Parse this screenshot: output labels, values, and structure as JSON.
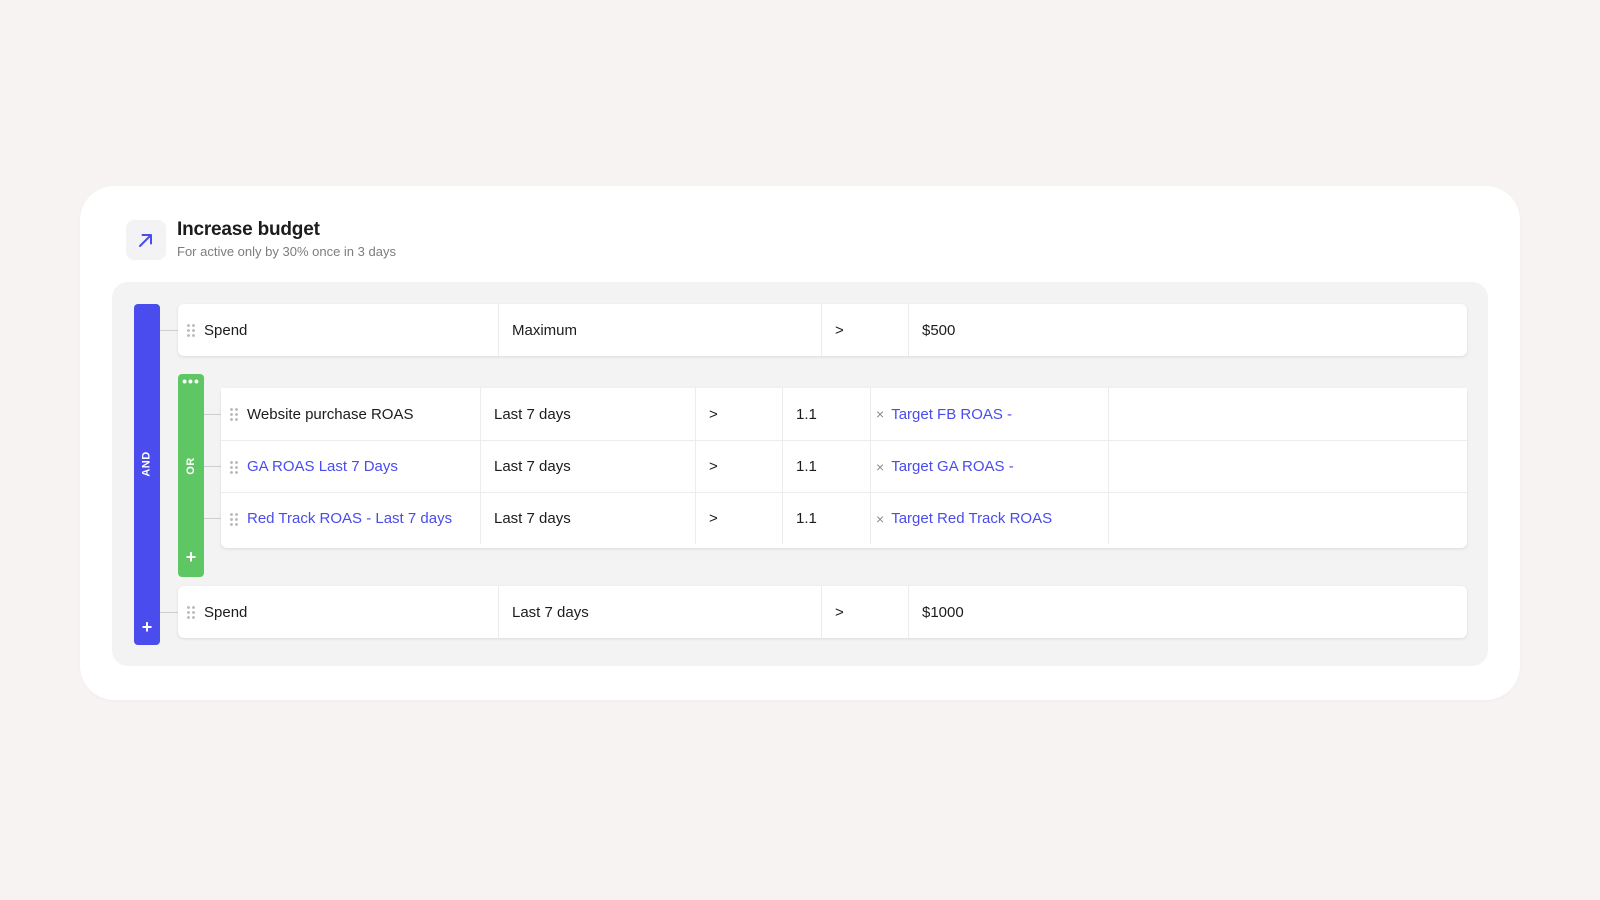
{
  "header": {
    "icon": "arrow-up-right-icon",
    "title": "Increase budget",
    "subtitle": "For active only by 30% once in 3 days"
  },
  "logic": {
    "and_label": "AND",
    "or_label": "OR",
    "add_symbol": "+",
    "more_symbol": "•••"
  },
  "rules": {
    "spend_max": {
      "metric": "Spend",
      "aggregation": "Maximum",
      "operator": ">",
      "value": "$500"
    },
    "or_group": [
      {
        "metric": "Website purchase ROAS",
        "metric_is_link": false,
        "period": "Last 7 days",
        "operator": ">",
        "value": "1.1",
        "multiplier_symbol": "×",
        "target": "Target FB ROAS -"
      },
      {
        "metric": "GA ROAS Last 7 Days",
        "metric_is_link": true,
        "period": "Last 7 days",
        "operator": ">",
        "value": "1.1",
        "multiplier_symbol": "×",
        "target": "Target GA ROAS -"
      },
      {
        "metric": "Red Track ROAS - Last 7 days",
        "metric_is_link": true,
        "period": "Last 7 days",
        "operator": ">",
        "value": "1.1",
        "multiplier_symbol": "×",
        "target": "Target Red Track ROAS"
      }
    ],
    "spend_7d": {
      "metric": "Spend",
      "aggregation": "Last 7 days",
      "operator": ">",
      "value": "$1000"
    }
  },
  "colors": {
    "and_bar": "#4a4ced",
    "or_bar": "#5fc664",
    "link": "#4a4ced",
    "card_bg": "#ffffff",
    "page_bg": "#f6f3f2"
  }
}
